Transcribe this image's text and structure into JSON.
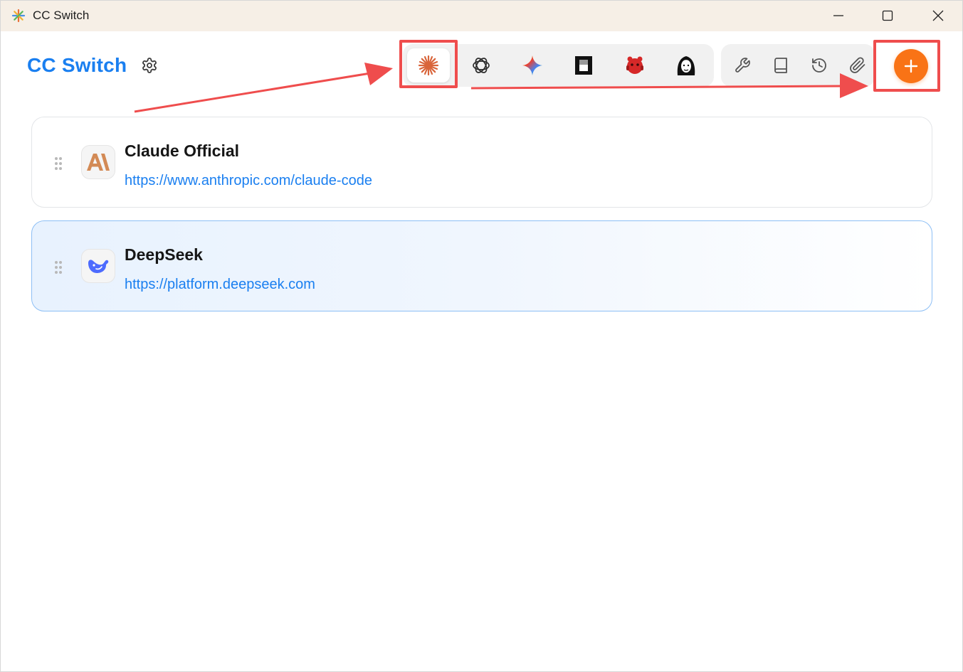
{
  "window": {
    "title": "CC Switch"
  },
  "header": {
    "brand": "CC Switch",
    "settings_icon": "gear-icon"
  },
  "app_switcher": {
    "items": [
      {
        "name": "claude",
        "icon": "claude-sparkle-icon",
        "active": true
      },
      {
        "name": "codex",
        "icon": "openai-icon",
        "active": false
      },
      {
        "name": "gemini",
        "icon": "gemini-star-icon",
        "active": false
      },
      {
        "name": "app-4",
        "icon": "black-square-icon",
        "active": false
      },
      {
        "name": "app-5",
        "icon": "red-creature-icon",
        "active": false
      },
      {
        "name": "app-6",
        "icon": "face-avatar-icon",
        "active": false
      }
    ]
  },
  "tools": [
    {
      "name": "wrench",
      "icon": "wrench-icon"
    },
    {
      "name": "book",
      "icon": "book-icon"
    },
    {
      "name": "history",
      "icon": "history-icon"
    },
    {
      "name": "paperclip",
      "icon": "paperclip-icon"
    }
  ],
  "add_button": {
    "icon": "plus-icon"
  },
  "providers": [
    {
      "name": "Claude Official",
      "url": "https://www.anthropic.com/claude-code",
      "logo": "anthropic-logo-icon",
      "selected": false
    },
    {
      "name": "DeepSeek",
      "url": "https://platform.deepseek.com",
      "logo": "deepseek-whale-icon",
      "selected": true
    }
  ],
  "colors": {
    "accent": "#1a7ff0",
    "add_button": "#f97316",
    "annotation": "#ef4d4d",
    "titlebar": "#f6efe6"
  }
}
